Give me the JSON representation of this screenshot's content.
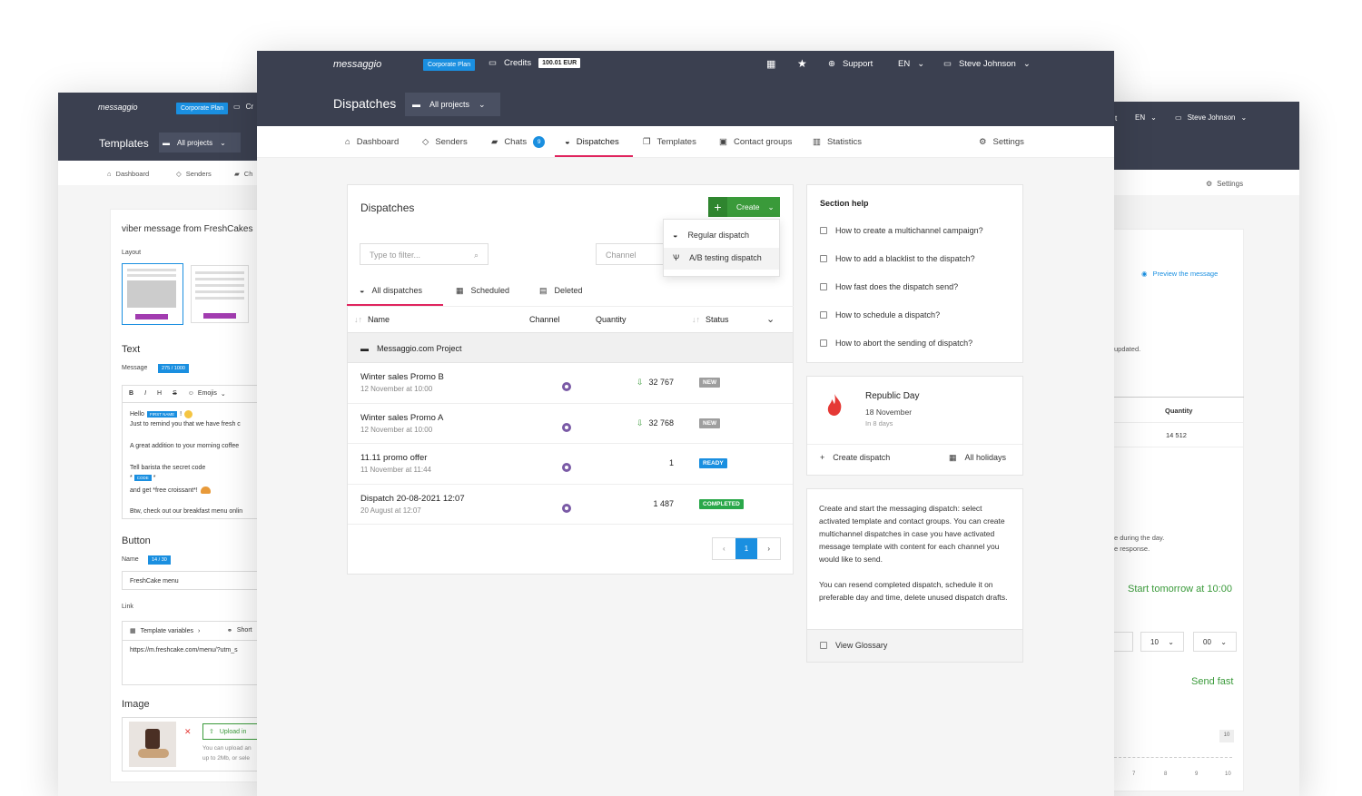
{
  "left_window": {
    "logo": "messaggio",
    "plan": "Corporate Plan",
    "credits_cut": "Cr",
    "page_title": "Templates",
    "projects": "All projects",
    "nav": [
      "Dashboard",
      "Senders",
      "Ch"
    ],
    "form_title": "viber message from FreshCakes",
    "layout_label": "Layout",
    "text_section": "Text",
    "message_label": "Message",
    "message_count": "275 / 1000",
    "toolbar": {
      "bold": "B",
      "italic": "I",
      "heading": "H",
      "strike": "S",
      "emojis": "Emojis"
    },
    "message_lines": {
      "hello": "Hello",
      "first_name_tag": "FIRST NAME",
      "exclaim": "!",
      "line1": "Just to remind you that we have fresh c",
      "line2": "A great addition to your morning coffee",
      "line3": "Tell barista the secret code",
      "code_pre": "*",
      "code_tag": "CODE",
      "code_post": "*",
      "line4": "and get *free croissant*!",
      "line5": "Btw, check out our breakfast menu onlin"
    },
    "button_section": "Button",
    "name_label": "Name",
    "name_count": "14 / 30",
    "name_value": "FreshCake menu",
    "link_label": "Link",
    "template_variables": "Template variables",
    "shorten": "Short",
    "link_value": "https://m.freshcake.com/menu/?utm_s",
    "image_section": "Image",
    "upload": "Upload in",
    "upload_hint1": "You can upload an",
    "upload_hint2": "up to 2Mb, or sele"
  },
  "right_window": {
    "lang": "EN",
    "user": "Steve Johnson",
    "settings": "Settings",
    "preview": "Preview the message",
    "updated": "updated.",
    "quantity_header": "Quantity",
    "quantity_value": "14 512",
    "during_day": "e during the day.",
    "response": "e response.",
    "start_tomorrow": "Start tomorrow at 10:00",
    "hour": "10",
    "minute": "00",
    "send_fast": "Send fast",
    "slider_value": "10",
    "ticks": [
      "7",
      "8",
      "9",
      "10"
    ]
  },
  "main": {
    "header": {
      "logo": "messaggio",
      "plan": "Corporate Plan",
      "credits_label": "Credits",
      "credits_value": "100.01 EUR",
      "support": "Support",
      "lang": "EN",
      "user": "Steve Johnson",
      "page_title": "Dispatches",
      "projects": "All projects"
    },
    "nav": {
      "dashboard": "Dashboard",
      "senders": "Senders",
      "chats": "Chats",
      "chats_count": "9",
      "dispatches": "Dispatches",
      "templates": "Templates",
      "contact_groups": "Contact groups",
      "statistics": "Statistics",
      "settings": "Settings"
    },
    "dispatches": {
      "title": "Dispatches",
      "create": "Create",
      "filter_placeholder": "Type to filter...",
      "channel_placeholder": "Channel",
      "dropdown": [
        "Regular dispatch",
        "A/B testing dispatch"
      ],
      "tabs": [
        "All dispatches",
        "Scheduled",
        "Deleted"
      ],
      "columns": {
        "name": "Name",
        "channel": "Channel",
        "quantity": "Quantity",
        "status": "Status"
      },
      "project": "Messaggio.com Project",
      "rows": [
        {
          "name": "Winter sales Promo B",
          "date": "12 November at 10:00",
          "quantity": "32 767",
          "status": "NEW",
          "status_color": "#9e9e9e"
        },
        {
          "name": "Winter sales Promo A",
          "date": "12 November at 10:00",
          "quantity": "32 768",
          "status": "NEW",
          "status_color": "#9e9e9e"
        },
        {
          "name": "11.11 promo offer",
          "date": "11 November at 11:44",
          "quantity": "1",
          "status": "READY",
          "status_color": "#1a8fe0"
        },
        {
          "name": "Dispatch 20-08-2021 12:07",
          "date": "20 August at 12:07",
          "quantity": "1 487",
          "status": "COMPLETED",
          "status_color": "#2aa84a"
        }
      ],
      "pager": {
        "prev": "‹",
        "page": "1",
        "next": "›"
      }
    },
    "help": {
      "title": "Section help",
      "items": [
        "How to create a multichannel campaign?",
        "How to add a blacklist to the dispatch?",
        "How fast does the dispatch send?",
        "How to schedule a dispatch?",
        "How to abort the sending of dispatch?"
      ]
    },
    "holiday": {
      "name": "Republic Day",
      "date": "18 November",
      "in_days": "In 8 days",
      "create": "Create dispatch",
      "all": "All holidays"
    },
    "info": {
      "p1": "Create and start the messaging dispatch: select activated template and contact groups. You can create multichannel dispatches in case you have activated message template with content for each channel you would like to send.",
      "p2": "You can resend completed dispatch, schedule it on preferable day and time, delete unused dispatch drafts.",
      "glossary": "View Glossary"
    }
  },
  "colors": {
    "header": "#3b4050",
    "accent": "#e0245e",
    "green": "#3a9a3a",
    "blue": "#1a8fe0"
  }
}
